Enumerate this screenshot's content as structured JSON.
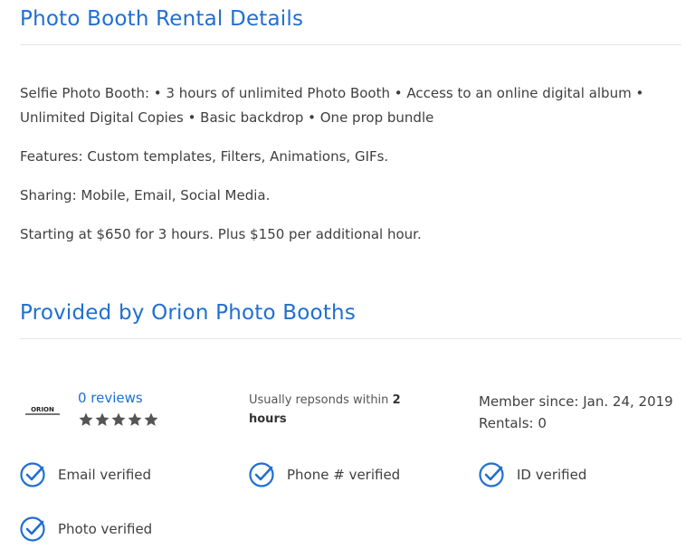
{
  "details": {
    "title": "Photo Booth Rental Details",
    "description": "Selfie Photo Booth: • 3 hours of unlimited Photo Booth • Access to an online digital album • Unlimited Digital Copies • Basic backdrop • One prop bundle",
    "features": "Features: Custom templates, Filters, Animations, GIFs.",
    "sharing": "Sharing: Mobile, Email, Social Media.",
    "pricing": "Starting at $650 for 3 hours. Plus $150 per additional hour."
  },
  "provider": {
    "title": "Provided by Orion Photo Booths",
    "logo_text": "ORION",
    "reviews_label": "0 reviews",
    "rating": 0,
    "rating_max": 5,
    "respond_prefix": "Usually repsonds within",
    "respond_value": "2 hours",
    "member_since": "Member since: Jan. 24, 2019",
    "rentals": "Rentals: 0"
  },
  "verifications": {
    "email": "Email verified",
    "phone": "Phone # verified",
    "id": "ID verified",
    "photo": "Photo verified"
  },
  "colors": {
    "accent": "#1f6fd1",
    "star_empty": "#555555",
    "text": "#3f3f3f"
  }
}
